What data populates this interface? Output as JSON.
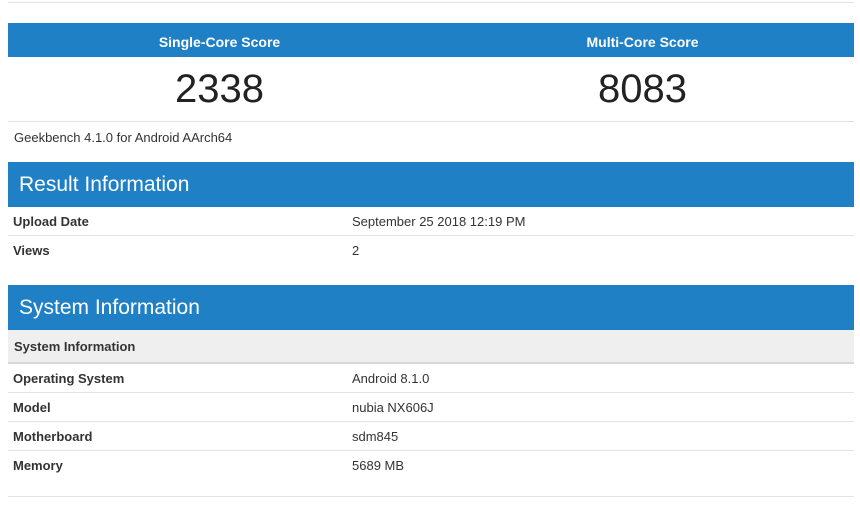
{
  "scores": {
    "single_label": "Single-Core Score",
    "multi_label": "Multi-Core Score",
    "single_value": "2338",
    "multi_value": "8083"
  },
  "version": "Geekbench 4.1.0 for Android AArch64",
  "result": {
    "title": "Result Information",
    "rows": [
      {
        "label": "Upload Date",
        "value": "September 25 2018 12:19 PM"
      },
      {
        "label": "Views",
        "value": "2"
      }
    ]
  },
  "system": {
    "title": "System Information",
    "subheader": "System Information",
    "rows": [
      {
        "label": "Operating System",
        "value": "Android 8.1.0"
      },
      {
        "label": "Model",
        "value": "nubia NX606J"
      },
      {
        "label": "Motherboard",
        "value": "sdm845"
      },
      {
        "label": "Memory",
        "value": "5689 MB"
      }
    ]
  },
  "colors": {
    "header_blue": "#2080c6",
    "subheader_gray": "#efefef"
  }
}
